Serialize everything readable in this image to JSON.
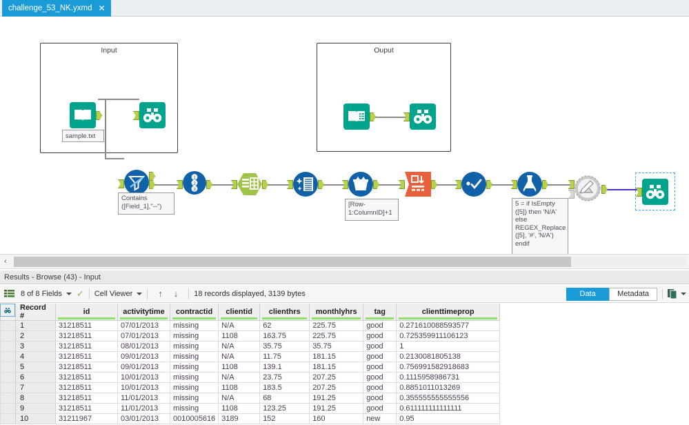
{
  "window": {
    "tab_title": "challenge_53_NK.yxmd",
    "tab_close": "✕"
  },
  "canvas": {
    "containers": [
      {
        "title": "Input"
      },
      {
        "title": "Ouput"
      }
    ],
    "annotations": [
      {
        "name": "filter-annotation",
        "text": "Contains\n([Field_1],\"--\")"
      },
      {
        "name": "multirow-annotation",
        "text": "[Row-\n1:ColumnID]+1"
      },
      {
        "name": "formula-annotation",
        "text": "5 = if IsEmpty\n([5]) then 'N/A'\nelse\nREGEX_Replace\n([5], '#', 'N/A')\nendif"
      },
      {
        "name": "input-file-annotation",
        "text": "sample.txt"
      }
    ],
    "tools": [
      {
        "name": "input-data-tool",
        "icon": "book-icon",
        "color": "#00a38c"
      },
      {
        "name": "browse-tool-input",
        "icon": "binoculars-icon",
        "color": "#00a38c"
      },
      {
        "name": "filter-tool",
        "icon": "funnel-icon",
        "color": "#1161a8"
      },
      {
        "name": "select-tool",
        "icon": "numbered-list-icon",
        "color": "#1161a8"
      },
      {
        "name": "text-to-columns-tool",
        "icon": "table-rows-icon",
        "color": "#a0c44a"
      },
      {
        "name": "data-cleansing-tool",
        "icon": "sparkle-building-icon",
        "color": "#1161a8"
      },
      {
        "name": "multi-row-formula-tool",
        "icon": "bucket-icon",
        "color": "#1161a8"
      },
      {
        "name": "transpose-tool",
        "icon": "crosstab-icon",
        "color": "#e8613c"
      },
      {
        "name": "dynamic-rename-tool",
        "icon": "check-dots-icon",
        "color": "#1161a8"
      },
      {
        "name": "formula-tool",
        "icon": "flask-icon",
        "color": "#1161a8"
      },
      {
        "name": "output-data-tool",
        "icon": "book-lines-icon",
        "color": "#00a38c"
      },
      {
        "name": "browse-tool-output",
        "icon": "binoculars-icon",
        "color": "#00a38c"
      },
      {
        "name": "disabled-tool",
        "icon": "gear-pencil-icon",
        "color": "#9a9a9a"
      },
      {
        "name": "browse-tool-final",
        "icon": "binoculars-icon",
        "color": "#00a38c"
      }
    ],
    "scroll": {
      "left_chevron": "‹"
    }
  },
  "results": {
    "header_title": "Results - Browse (43) - Input",
    "toolbar": {
      "fields_label": "8 of 8 Fields",
      "cell_viewer_label": "Cell Viewer",
      "arrow_up": "↑",
      "arrow_down": "↓",
      "record_status": "18 records displayed, 3139 bytes",
      "checkmark": "✓"
    },
    "tabs": [
      {
        "label": "Data",
        "active": true
      },
      {
        "label": "Metadata",
        "active": false
      }
    ],
    "copy_button": "copy-icon"
  },
  "table": {
    "columns": [
      "Record #",
      "id",
      "activitytime",
      "contractid",
      "clientid",
      "clienthrs",
      "monthlyhrs",
      "tag",
      "clienttimeprop"
    ],
    "rows": [
      [
        "1",
        "31218511",
        "07/01/2013",
        "missing",
        "N/A",
        "62",
        "225.75",
        "good",
        "0.271610088593577"
      ],
      [
        "2",
        "31218511",
        "07/01/2013",
        "missing",
        "1108",
        "163.75",
        "225.75",
        "good",
        "0.725359911106123"
      ],
      [
        "3",
        "31218511",
        "08/01/2013",
        "missing",
        "N/A",
        "35.75",
        "35.75",
        "good",
        "1"
      ],
      [
        "4",
        "31218511",
        "09/01/2013",
        "missing",
        "N/A",
        "11.75",
        "181.15",
        "good",
        "0.2130081805138"
      ],
      [
        "5",
        "31218511",
        "09/01/2013",
        "missing",
        "1108",
        "139.1",
        "181.15",
        "good",
        "0.756991582918683"
      ],
      [
        "6",
        "31218511",
        "10/01/2013",
        "missing",
        "N/A",
        "23.75",
        "207.25",
        "good",
        "0.1115958986731"
      ],
      [
        "7",
        "31218511",
        "10/01/2013",
        "missing",
        "1108",
        "183.5",
        "207.25",
        "good",
        "0.8851011013269"
      ],
      [
        "8",
        "31218511",
        "11/01/2013",
        "missing",
        "N/A",
        "68",
        "191.25",
        "good",
        "0.355555555555556"
      ],
      [
        "9",
        "31218511",
        "11/01/2013",
        "missing",
        "1108",
        "123.25",
        "191.25",
        "good",
        "0.611111111111111"
      ],
      [
        "10",
        "31211967",
        "03/01/2013",
        "0010005616",
        "3189",
        "152",
        "160",
        "new",
        "0.95"
      ]
    ]
  },
  "colors": {
    "accent_blue": "#1a9bd7",
    "tool_teal": "#00a38c",
    "tool_blue": "#1161a8",
    "tool_green": "#a0c44a",
    "tool_orange": "#e8613c",
    "anchor_green": "#b5d14b",
    "header_underline": "#8fe06a",
    "selected_conn": "#4a2fd0"
  }
}
